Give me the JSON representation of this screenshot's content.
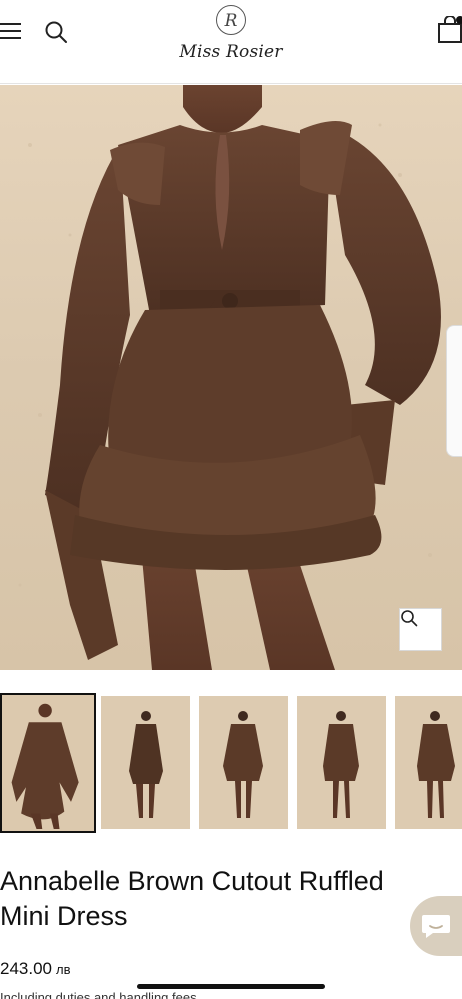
{
  "header": {
    "logo_monogram": "R",
    "logo_text": "Miss Rosier",
    "menu_icon": "hamburger-menu-icon",
    "search_icon": "search-icon",
    "cart_icon": "shopping-bag-icon"
  },
  "gallery": {
    "main_image_alt": "Model wearing brown ruffled mini dress with tie belt",
    "zoom_icon": "magnifier-icon",
    "thumbnail_count": 5,
    "active_thumbnail": 0
  },
  "product": {
    "title": "Annabelle Brown Cutout Ruffled Mini Dress",
    "price": "243.00",
    "currency": "лв",
    "duties_note": "Including duties and handling fees"
  },
  "chat": {
    "icon": "chat-bubble-icon"
  },
  "colors": {
    "dress_brown": "#5a3b2a",
    "backdrop_beige": "#dccab0",
    "chat_bg": "#d9cfbe"
  }
}
